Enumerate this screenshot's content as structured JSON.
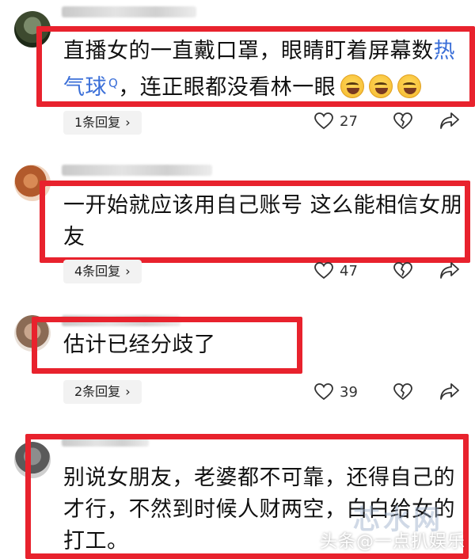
{
  "comments": [
    {
      "avatar": "avatar-photo",
      "text_line1": "直播女的一直戴口罩，眼睛盯着屏幕数",
      "hot_link": "热",
      "text_line2_link": "气球",
      "search_icon": "search-icon",
      "text_line2_rest": "，连正眼都没看林一眼",
      "emoji_count": 3,
      "emoji_name": "laughing-emoji",
      "reply_label": "1条回复",
      "likes": "27"
    },
    {
      "avatar": "avatar-photo",
      "text_line1": "一开始就应该用自己账号 这么能相信女朋",
      "text_line2": "友",
      "reply_label": "4条回复",
      "likes": "47"
    },
    {
      "avatar": "avatar-photo",
      "text_line1": "估计已经分歧了",
      "reply_label": "2条回复",
      "likes": "39"
    },
    {
      "avatar": "avatar-photo",
      "text_line1": "别说女朋友，老婆都不可靠，还得自己的",
      "text_line2": "才行，不然到时候人财两空，白白给女的",
      "text_line3": "打工。"
    }
  ],
  "chevron": "›",
  "watermark": "头条@一点扒娱乐",
  "watermark_overlay": "芯水网",
  "colors": {
    "highlight_box": "#e8222d",
    "link": "#3b6fd8",
    "pill_bg": "#f2f2f2"
  }
}
